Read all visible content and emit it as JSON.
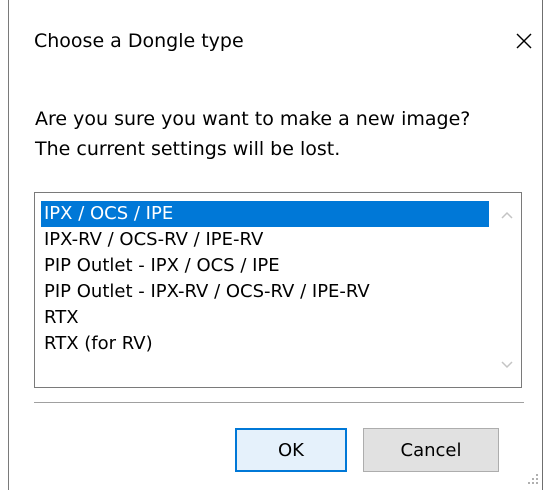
{
  "dialog": {
    "title": "Choose a Dongle type",
    "message_line1": "Are you sure you want to make a new image?",
    "message_line2": "The current settings will be lost.",
    "selected_index": 0,
    "options": [
      {
        "label": "IPX / OCS / IPE"
      },
      {
        "label": "IPX-RV / OCS-RV / IPE-RV"
      },
      {
        "label": "PIP Outlet - IPX / OCS / IPE"
      },
      {
        "label": "PIP Outlet - IPX-RV / OCS-RV / IPE-RV"
      },
      {
        "label": "RTX"
      },
      {
        "label": "RTX (for RV)"
      }
    ],
    "ok_label": "OK",
    "cancel_label": "Cancel"
  },
  "icons": {
    "close": "close-icon",
    "scroll_up": "chevron-up-icon",
    "scroll_down": "chevron-down-icon",
    "resize": "resize-grip-icon"
  },
  "colors": {
    "selection": "#0078d7",
    "default_button_border": "#0078d7",
    "default_button_bg": "#e5f1fb",
    "button_bg": "#e1e1e1"
  }
}
